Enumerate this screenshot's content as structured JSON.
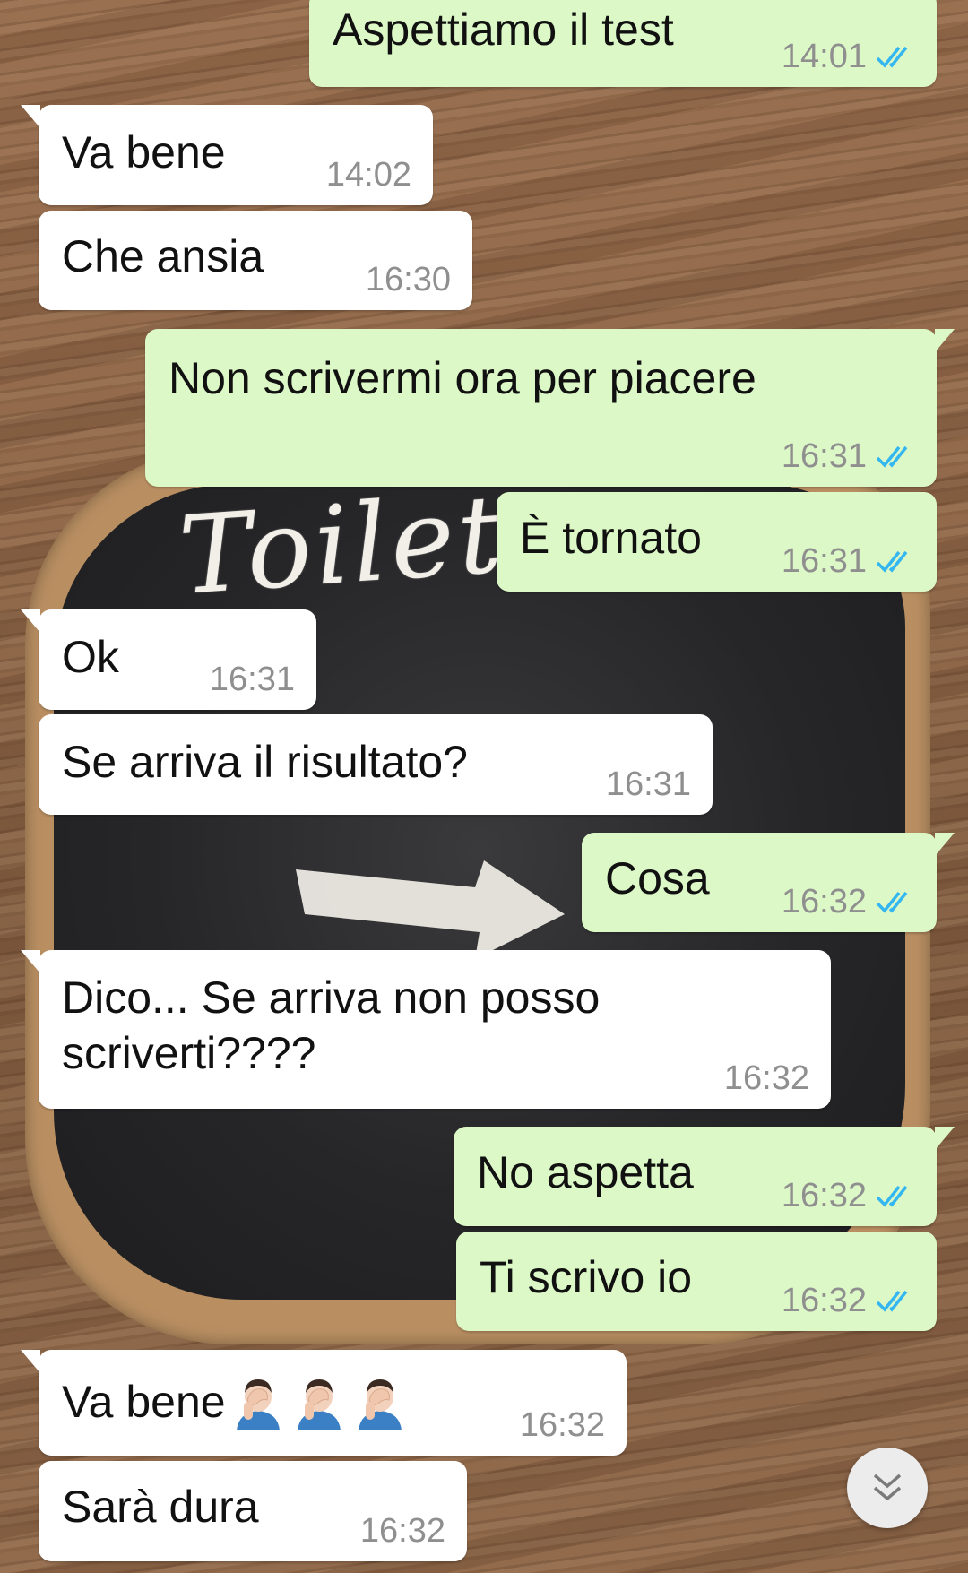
{
  "chat": {
    "messages": [
      {
        "dir": "out",
        "text": "Aspettiamo il test",
        "time": "14:01",
        "read": true
      },
      {
        "dir": "in",
        "text": "Va bene",
        "time": "14:02"
      },
      {
        "dir": "in",
        "text": "Che ansia",
        "time": "16:30"
      },
      {
        "dir": "out",
        "text": "Non scrivermi ora per piacere",
        "time": "16:31",
        "read": true
      },
      {
        "dir": "out",
        "text": "È tornato",
        "time": "16:31",
        "read": true
      },
      {
        "dir": "in",
        "text": "Ok",
        "time": "16:31"
      },
      {
        "dir": "in",
        "text": "Se arriva il risultato?",
        "time": "16:31"
      },
      {
        "dir": "out",
        "text": "Cosa",
        "time": "16:32",
        "read": true
      },
      {
        "dir": "in",
        "text": "Dico... Se arriva non posso scriverti????",
        "time": "16:32"
      },
      {
        "dir": "out",
        "text": "No aspetta",
        "time": "16:32",
        "read": true
      },
      {
        "dir": "out",
        "text": "Ti scrivo io",
        "time": "16:32",
        "read": true
      },
      {
        "dir": "in",
        "text": "Va bene",
        "emoji_count": 3,
        "emoji": "man-facepalming",
        "time": "16:32"
      },
      {
        "dir": "in",
        "text": "Sarà dura",
        "time": "16:32"
      }
    ]
  },
  "wallpaper": {
    "chalk_text": "Toilette"
  },
  "icons": {
    "read_receipt": "double-check-icon",
    "scroll_down": "double-chevron-down-icon"
  },
  "colors": {
    "incoming_bubble": "#ffffff",
    "outgoing_bubble": "#dcf8c6",
    "read_tick": "#34b7f1",
    "timestamp": "#8f8f8f"
  }
}
